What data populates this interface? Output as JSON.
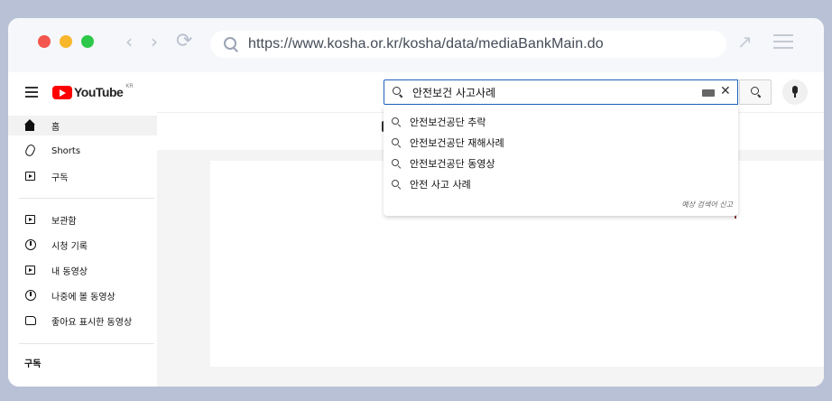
{
  "browser": {
    "url": "https://www.kosha.or.kr/kosha/data/mediaBankMain.do"
  },
  "youtube": {
    "logo_text": "YouTube",
    "region": "KR",
    "search_query": "안전보건 사고사례",
    "suggestions": [
      "안전보건공단 추락",
      "안전보건공단 재해사례",
      "안전보건공단 동영상",
      "안전 사고 사례"
    ],
    "report_link": "예상 검색어 신고"
  },
  "sidebar": {
    "items": [
      {
        "label": "홈",
        "icon": "home-icon"
      },
      {
        "label": "Shorts",
        "icon": "shorts-icon"
      },
      {
        "label": "구독",
        "icon": "subscriptions-icon"
      },
      {
        "label": "보관함",
        "icon": "library-icon"
      },
      {
        "label": "시청 기록",
        "icon": "history-icon"
      },
      {
        "label": "내 동영상",
        "icon": "your-videos-icon"
      },
      {
        "label": "나중에 볼 동영상",
        "icon": "watch-later-icon"
      },
      {
        "label": "좋아요 표시한 동영상",
        "icon": "liked-videos-icon"
      }
    ],
    "section_title": "구독"
  }
}
